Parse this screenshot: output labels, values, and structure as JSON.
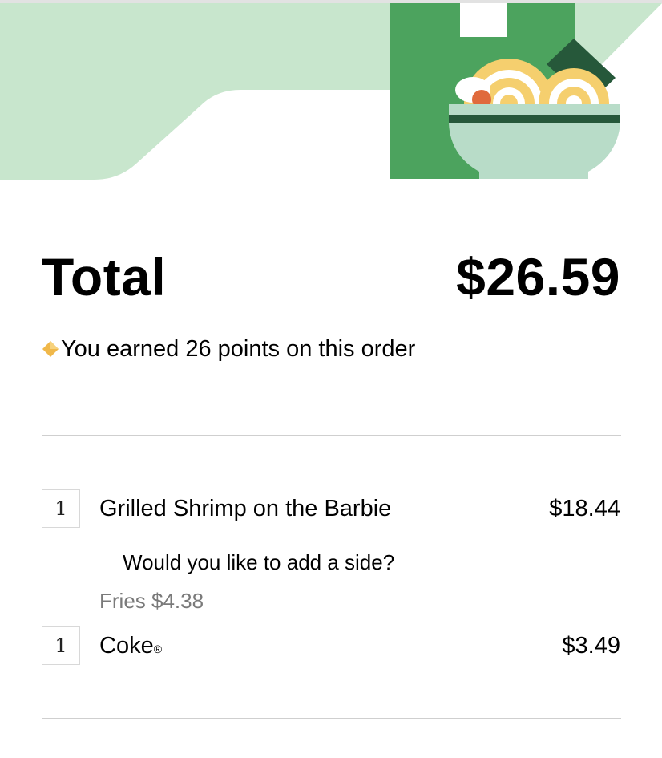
{
  "colors": {
    "hero_mint": "#c8e6cd",
    "hero_green": "#4ca35e",
    "bowl_mint": "#b8dcc8",
    "bowl_stripe": "#26583a",
    "noodle_yellow": "#f5cf6e",
    "points_icon": "#f0b84a",
    "secondary_text": "#7a7a7a"
  },
  "hero": {
    "illustration_icon": "noodle-bowl-icon"
  },
  "summary": {
    "total_label": "Total",
    "total_amount": "$26.59",
    "points_icon": "diamond-icon",
    "points_text": "You earned 26 points on this order"
  },
  "items": [
    {
      "qty": "1",
      "name": "Grilled Shrimp on the Barbie",
      "price": "$18.44",
      "option_question": "Would you like to add a side?",
      "option_value": "Fries $4.38"
    },
    {
      "qty": "1",
      "name": "Coke",
      "name_mark": "®",
      "price": "$3.49"
    }
  ]
}
